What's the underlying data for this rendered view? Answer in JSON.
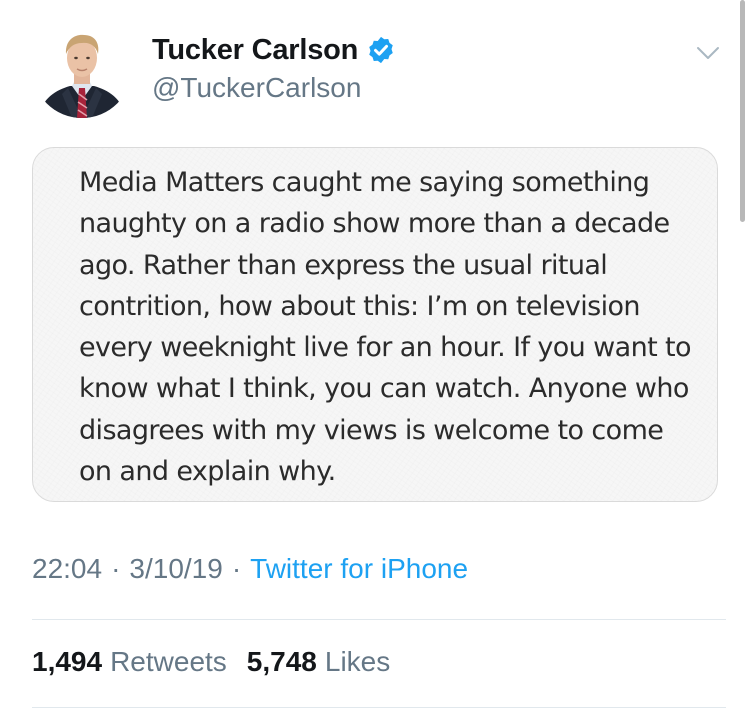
{
  "author": {
    "display_name": "Tucker Carlson",
    "handle": "@TuckerCarlson",
    "verified": true,
    "avatar_icon": "profile-photo"
  },
  "menu_icon": "chevron-down-icon",
  "note": {
    "lines": [
      "Media Matters caught me saying something",
      "naughty on a radio show more than a decade",
      "ago. Rather than express the usual ritual",
      "contrition, how about this: I’m on television",
      "every weeknight live for an hour. If you want to",
      "know what I think, you can watch. Anyone who",
      "disagrees with my views is welcome to come",
      "on and explain why."
    ]
  },
  "meta": {
    "time": "22:04",
    "separator": "·",
    "date": "3/10/19",
    "source": "Twitter for iPhone"
  },
  "stats": {
    "retweets_count": "1,494",
    "retweets_label": "Retweets",
    "likes_count": "5,748",
    "likes_label": "Likes"
  },
  "colors": {
    "link_blue": "#1da1f2",
    "secondary_gray": "#657786",
    "verified_blue": "#1da1f2"
  }
}
